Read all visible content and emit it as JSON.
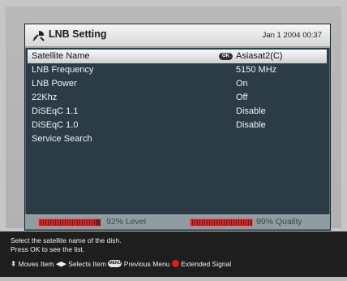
{
  "header": {
    "title": "LNB Setting",
    "icon": "satellite-dish-icon",
    "datetime": "Jan 1 2004 00:37"
  },
  "settings": [
    {
      "label": "Satellite Name",
      "value": "Asiasat2(C)",
      "badge": "OK",
      "selected": true
    },
    {
      "label": "LNB Frequency",
      "value": "5150 MHz"
    },
    {
      "label": "LNB Power",
      "value": "On"
    },
    {
      "label": "22Khz",
      "value": "Off"
    },
    {
      "label": "DiSEqC 1.1",
      "value": "Disable"
    },
    {
      "label": "DiSEqC 1.0",
      "value": "Disable"
    },
    {
      "label": "Service Search",
      "value": ""
    }
  ],
  "signal": {
    "level_percent": 92,
    "level_text": "92% Level",
    "quality_percent": 99,
    "quality_text": "99% Quality",
    "bar_color": "#c92b2b"
  },
  "help": {
    "line1": "Select the satellite name of the dish.",
    "line2": "Press OK to see the list."
  },
  "legend": {
    "moves": "Moves Item",
    "selects": "Selects Item",
    "menu_badge": "MENU",
    "previous": "Previous Menu",
    "extended": "Extended Signal",
    "extended_color": "#e11b1b"
  }
}
